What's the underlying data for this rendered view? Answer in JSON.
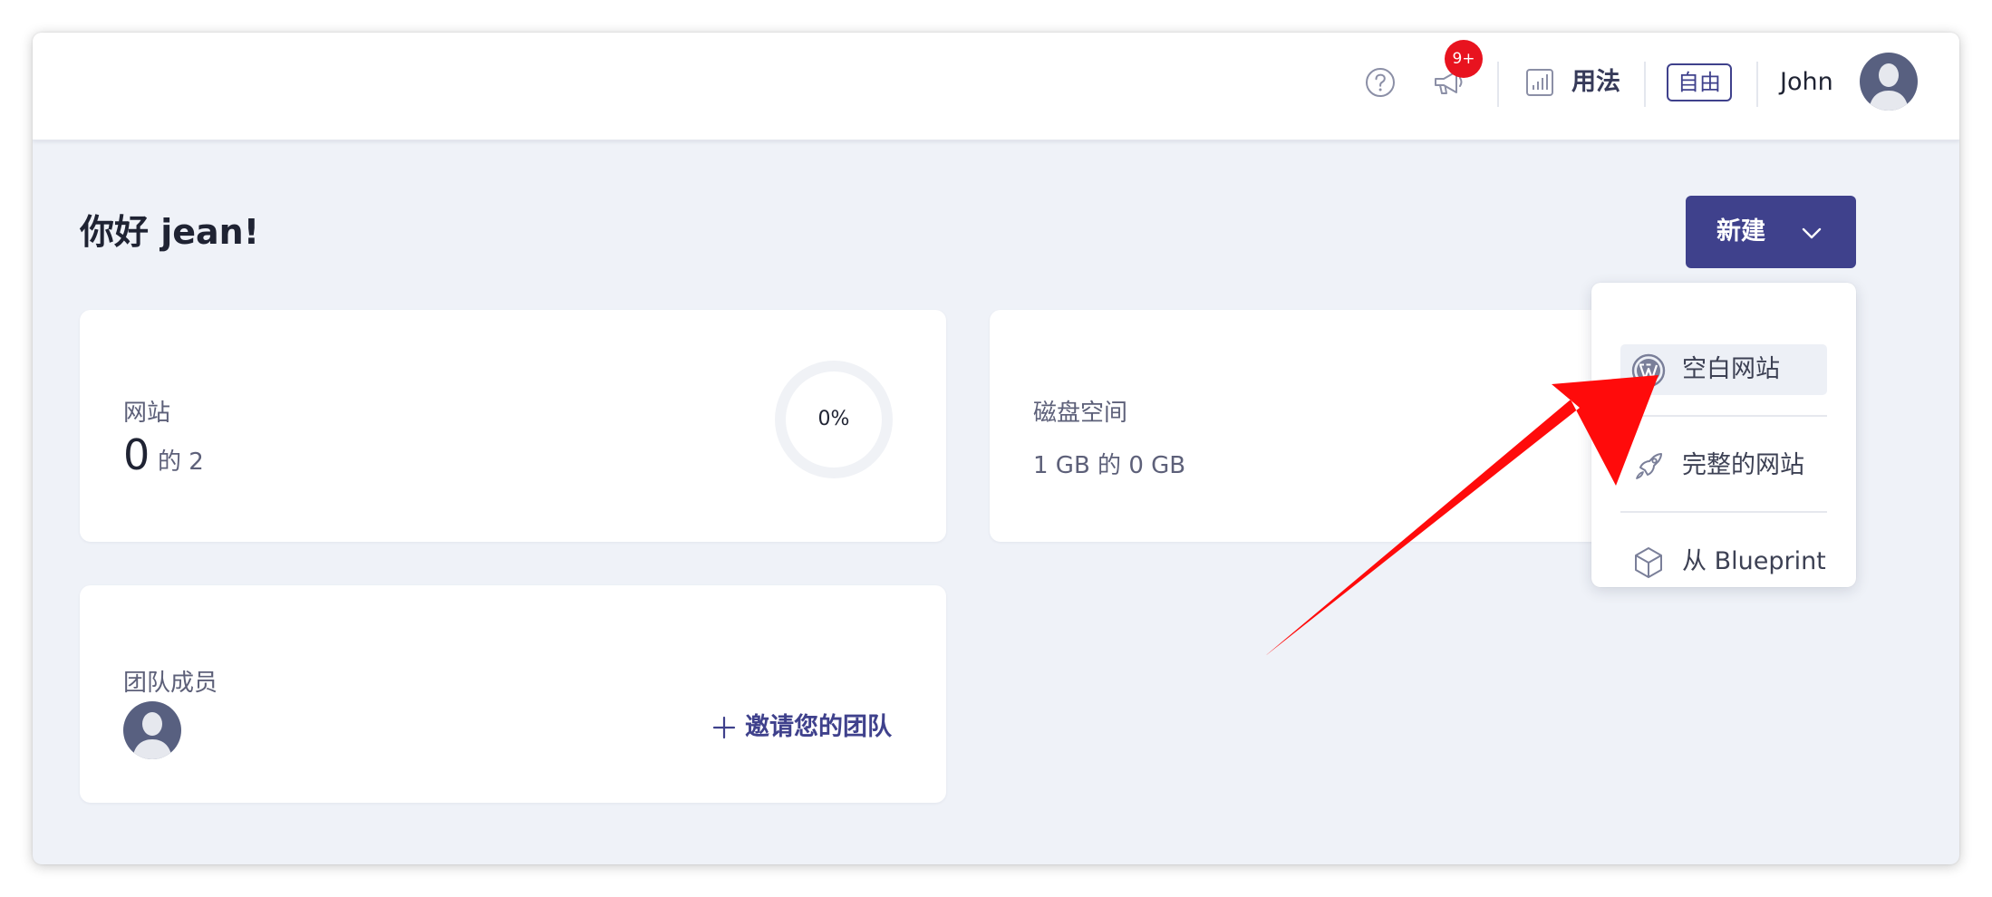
{
  "header": {
    "notification_badge": "9+",
    "usage_label": "用法",
    "plan_label": "自由",
    "user_name": "John"
  },
  "icons": {
    "help": "help-circle-icon",
    "announcements": "megaphone-icon",
    "usage": "bar-chart-icon",
    "dropdown": "chevron-down-icon",
    "wordpress": "wordpress-icon",
    "rocket": "rocket-icon",
    "blueprint": "cube-icon",
    "invite": "plus-icon"
  },
  "dashboard": {
    "greeting": "你好 jean!",
    "new_button_label": "新建",
    "sites_card": {
      "title": "网站",
      "count": "0",
      "of_total": "的 2",
      "percent": "0%"
    },
    "disk_card": {
      "title": "磁盘空间",
      "value": "1 GB 的 0 GB"
    },
    "team_card": {
      "title": "团队成员",
      "invite_label": "邀请您的团队"
    }
  },
  "new_menu": {
    "items": [
      {
        "label": "空白网站",
        "icon": "wordpress-icon",
        "highlighted": true
      },
      {
        "label": "完整的网站",
        "icon": "rocket-icon",
        "highlighted": false
      },
      {
        "label": "从 Blueprint",
        "icon": "cube-icon",
        "highlighted": false
      }
    ]
  },
  "colors": {
    "primary": "#3f418c",
    "badge_red": "#e8131f",
    "background": "#eff2f8",
    "annotation_arrow": "#ff0000"
  }
}
